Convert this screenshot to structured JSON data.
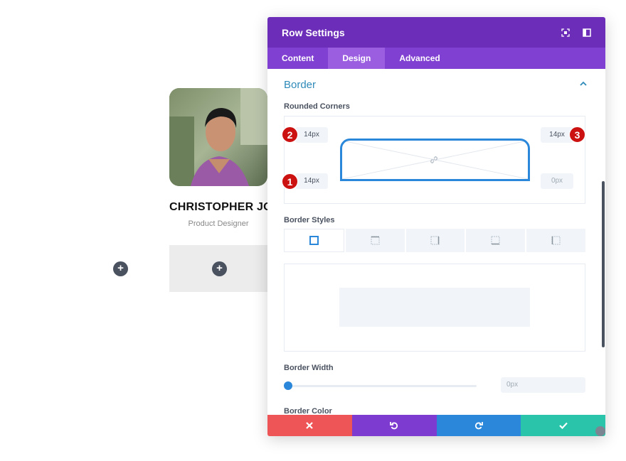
{
  "profile": {
    "name": "CHRISTOPHER JOE",
    "role": "Product Designer"
  },
  "modal": {
    "title": "Row Settings",
    "tabs": [
      {
        "label": "Content"
      },
      {
        "label": "Design"
      },
      {
        "label": "Advanced"
      }
    ],
    "active_tab": "Design",
    "section_title": "Border",
    "rounded_corners_label": "Rounded Corners",
    "corners": {
      "top_left": "14px",
      "top_right": "14px",
      "bottom_left": "14px",
      "bottom_right": "0px"
    },
    "badges": [
      "1",
      "2",
      "3"
    ],
    "border_styles_label": "Border Styles",
    "border_width_label": "Border Width",
    "border_width_value": "0px",
    "border_color_label": "Border Color",
    "footer_buttons": [
      {
        "icon": "close-icon",
        "color": "#ee5557"
      },
      {
        "icon": "undo-icon",
        "color": "#7e3bd0"
      },
      {
        "icon": "redo-icon",
        "color": "#2b87da"
      },
      {
        "icon": "check-icon",
        "color": "#29c4a9"
      }
    ]
  },
  "colors": {
    "header": "#6c2eb9",
    "tabs": "#8040d2",
    "accent": "#2b87da",
    "section_title": "#2e8ab8",
    "badge": "#cc1111"
  }
}
